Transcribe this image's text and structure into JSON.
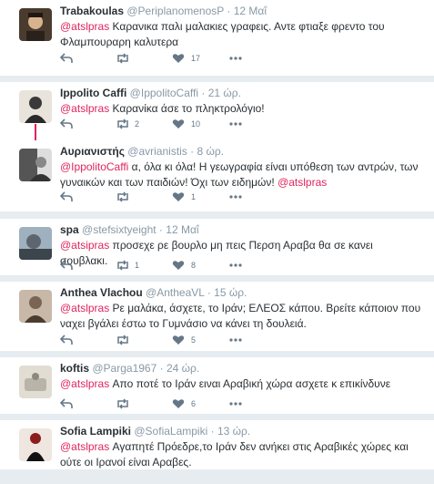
{
  "tweets": [
    {
      "name": "Trabakoulas",
      "handle": "@PeriplanomenosP",
      "time": "12 Μαΐ",
      "mention": "@atslpras",
      "text": " Καρανικα παλι μαλακιες γραφεις. Αντε φτιαξε φρεντο του Φλαμπουραρη καλυτερα",
      "mention_tail": "",
      "text_tail": "",
      "retweets": "",
      "likes": "17",
      "avatar_color": "#4a3b2f"
    },
    {
      "name": "Ippolito Caffi",
      "handle": "@IppolitoCaffi",
      "time": "21 ώρ.",
      "mention": "@atslpras",
      "text": " Καρανίκα άσε το πληκτρολόγιο!",
      "mention_tail": "",
      "text_tail": "",
      "retweets": "2",
      "likes": "10",
      "avatar_color": "#3a3a3a"
    },
    {
      "name": "Αυριανιστής",
      "handle": "@avrianistis",
      "time": "8 ώρ.",
      "mention": "@IppolitoCaffi",
      "text": " α, όλα κι όλα! Η γεωγραφία είναι υπόθεση των αντρών, των γυναικών και των παιδιών! Όχι των ειδημών! ",
      "mention_tail": "@atslpras",
      "text_tail": "",
      "retweets": "",
      "likes": "1",
      "avatar_color": "#555555"
    },
    {
      "name": "spa",
      "handle": "@stefsixtyeight",
      "time": "12 Μαΐ",
      "mention": "@atsipras",
      "text": " προσεχε ρε βουρλο μη πεις Περση Αραβα θα σε κανει σουβλακι.",
      "mention_tail": "",
      "text_tail": "",
      "retweets": "1",
      "likes": "8",
      "avatar_color": "#6f7d8a"
    },
    {
      "name": "Anthea Vlachou",
      "handle": "@AntheaVL",
      "time": "15 ώρ.",
      "mention": "@atslpras",
      "text": " Ρε μαλάκα, άσχετε, το Ιράν; ΕΛΕΟΣ κάπου. Βρείτε κάποιον που ναχει βγάλει έστω το Γυμνάσιο να κάνει τη δουλειά.",
      "mention_tail": "",
      "text_tail": "",
      "retweets": "",
      "likes": "5",
      "avatar_color": "#7a6555"
    },
    {
      "name": "koftis",
      "handle": "@Parga1967",
      "time": "24 ώρ.",
      "mention": "@atslpras",
      "text": " Απο ποτέ το Ιράν ειναι Αραβική χώρα ασχετε κ επικίνδυνε",
      "mention_tail": "",
      "text_tail": "",
      "retweets": "",
      "likes": "6",
      "avatar_color": "#b9b4a8"
    },
    {
      "name": "Sofia Lampiki",
      "handle": "@SofiaLampiki",
      "time": "13 ώρ.",
      "mention": "@atslpras",
      "text": " Αγαπητέ Πρόεδρε,το Ιράν δεν ανήκει στις Αραβικές χώρες και ούτε οι Ιρανοί είναι Αραβες.",
      "mention_tail": "",
      "text_tail": "",
      "retweets": "",
      "likes": "",
      "avatar_color": "#8b1d1d"
    }
  ],
  "colors": {
    "accent": "#e0245e",
    "muted": "#8899a6",
    "icon": "#657786",
    "background": "#e6ecf0"
  },
  "icons": [
    "reply-icon",
    "retweet-icon",
    "like-icon",
    "more-icon"
  ]
}
